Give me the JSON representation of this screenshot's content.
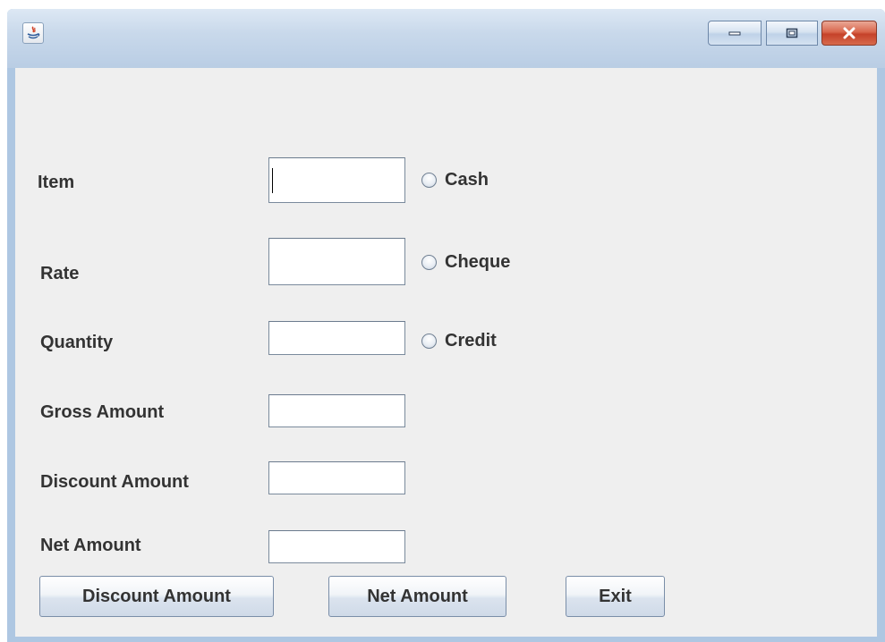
{
  "window": {
    "controls": {
      "minimize_icon": "minimize-icon",
      "maximize_icon": "restore-icon",
      "close_icon": "close-icon"
    }
  },
  "form": {
    "labels": {
      "item": "Item",
      "rate": "Rate",
      "quantity": "Quantity",
      "gross_amount": "Gross Amount",
      "discount_amount": "Discount Amount",
      "net_amount": "Net Amount"
    },
    "fields": {
      "item": "",
      "rate": "",
      "quantity": "",
      "gross_amount": "",
      "discount_amount": "",
      "net_amount": ""
    }
  },
  "payment": {
    "options": [
      {
        "label": "Cash",
        "selected": false
      },
      {
        "label": "Cheque",
        "selected": false
      },
      {
        "label": "Credit",
        "selected": false
      }
    ]
  },
  "buttons": {
    "discount_amount": "Discount Amount",
    "net_amount": "Net Amount",
    "exit": "Exit"
  },
  "colors": {
    "title_bar": "#c9d9eb",
    "panel": "#efefef",
    "close_button": "#c5422a",
    "label_text": "#333333"
  }
}
